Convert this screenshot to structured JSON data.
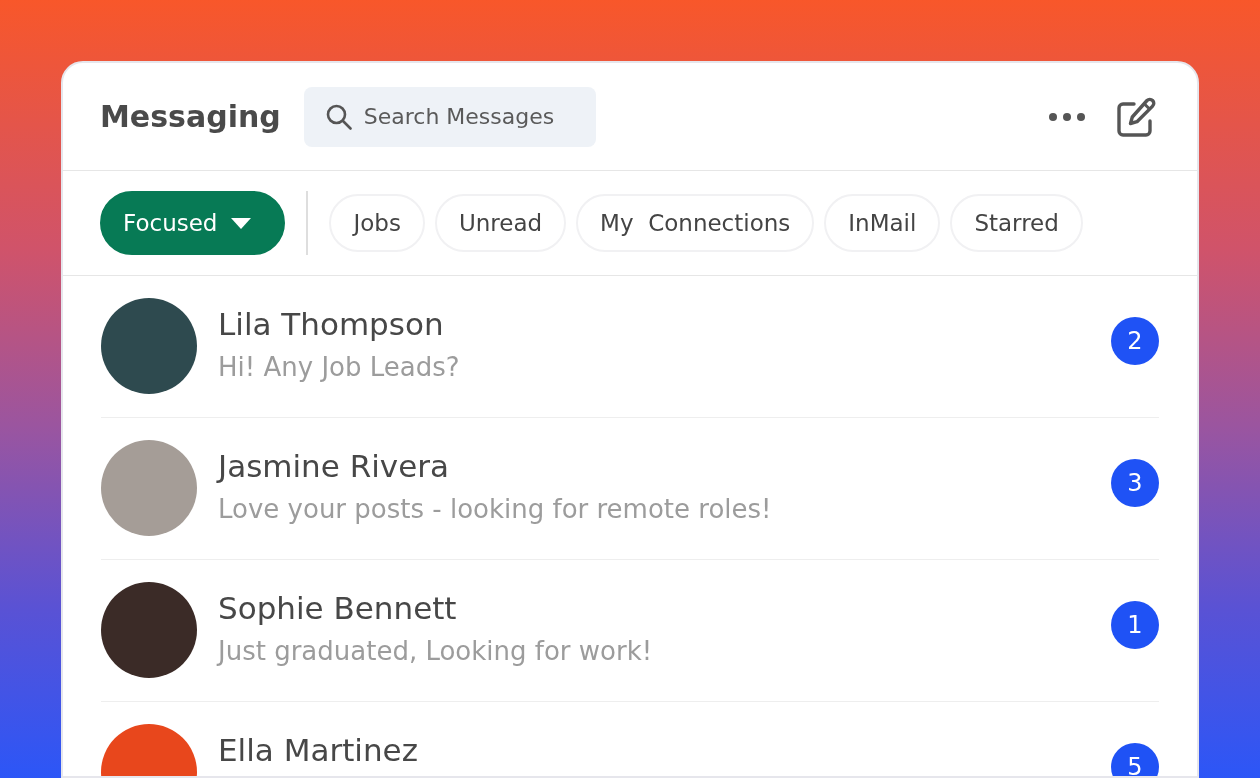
{
  "header": {
    "title": "Messaging",
    "search": {
      "placeholder": "Search Messages"
    }
  },
  "filters": [
    {
      "label": "Focused",
      "kind": "dropdown",
      "selected": true
    },
    {
      "label": "Jobs",
      "kind": "chip",
      "selected": false
    },
    {
      "label": "Unread",
      "kind": "chip",
      "selected": false
    },
    {
      "label": "My  Connections",
      "kind": "chip",
      "selected": false
    },
    {
      "label": "InMail",
      "kind": "chip",
      "selected": false
    },
    {
      "label": "Starred",
      "kind": "chip",
      "selected": false
    }
  ],
  "conversations": [
    {
      "name": "Lila Thompson",
      "preview": "Hi! Any Job Leads?",
      "unread": "2"
    },
    {
      "name": "Jasmine Rivera",
      "preview": "Love your posts - looking for remote roles!",
      "unread": "3"
    },
    {
      "name": "Sophie Bennett",
      "preview": "Just graduated, Looking for work!",
      "unread": "1"
    },
    {
      "name": "Ella Martinez",
      "unread": "5"
    }
  ]
}
